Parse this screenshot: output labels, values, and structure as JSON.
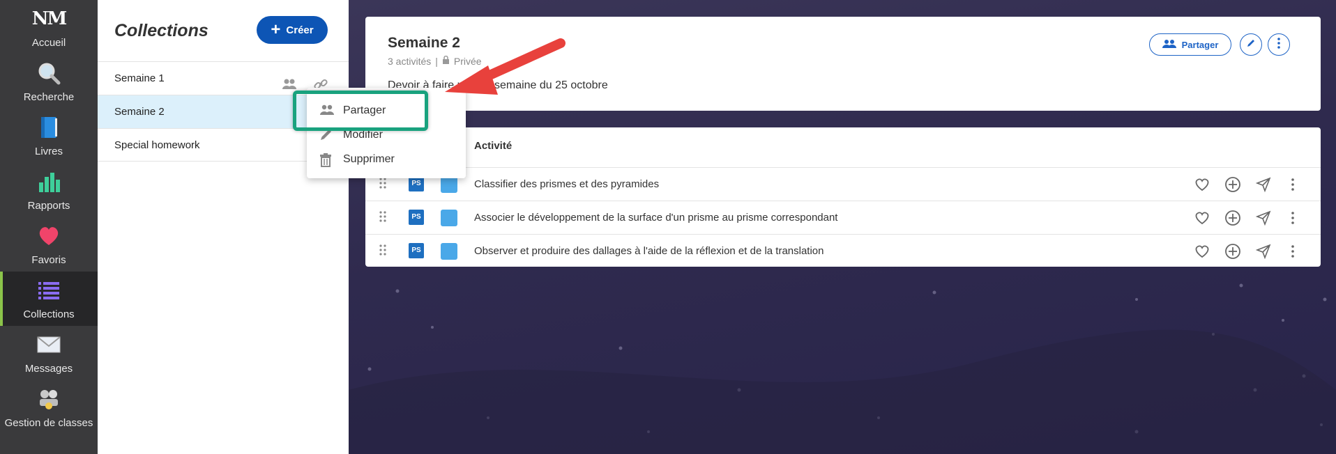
{
  "nav": {
    "items": [
      {
        "label": "Accueil",
        "icon": "logo-nm-icon"
      },
      {
        "label": "Recherche",
        "icon": "magnifier-icon"
      },
      {
        "label": "Livres",
        "icon": "book-icon"
      },
      {
        "label": "Rapports",
        "icon": "bar-chart-icon"
      },
      {
        "label": "Favoris",
        "icon": "heart-icon"
      },
      {
        "label": "Collections",
        "icon": "list-icon",
        "active": true
      },
      {
        "label": "Messages",
        "icon": "envelope-icon"
      },
      {
        "label": "Gestion de classes",
        "icon": "group-icon"
      }
    ],
    "logo_text": "NM"
  },
  "panel": {
    "title": "Collections",
    "help_glyph": "?",
    "create_label": "Créer",
    "collections": [
      "Semaine 1",
      "Semaine 2",
      "Special homework"
    ]
  },
  "context_menu": {
    "items": [
      "Partager",
      "Modifier",
      "Supprimer"
    ]
  },
  "collection_card": {
    "title": "Semaine 2",
    "activity_count": "3 activités",
    "separator": "|",
    "visibility": "Privée",
    "description": "Devoir à faire pour la semaine du 25 octobre",
    "share_label": "Partager"
  },
  "activities_table": {
    "header": "Activité",
    "ps_badge": "PS",
    "rows": [
      "Classifier des prismes et des pyramides",
      "Associer le développement de la surface d'un prisme au prisme correspondant",
      "Observer et produire des dallages à l'aide de la réflexion et de la translation"
    ]
  },
  "colors": {
    "accent": "#0d55b5",
    "highlight_box": "#19a27e",
    "annotation_arrow": "#e8413c",
    "selected_row": "#dcf0fb"
  }
}
